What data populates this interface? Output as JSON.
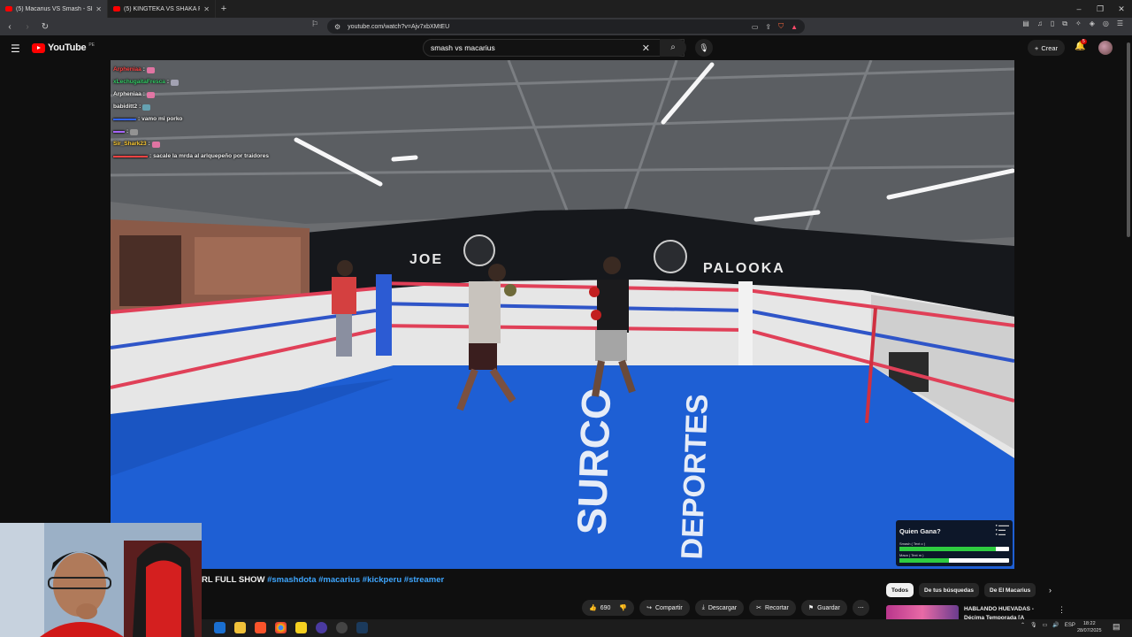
{
  "browser": {
    "tabs": [
      {
        "title": "(5) Macarius VS Smash - SPA..."
      },
      {
        "title": "(5) KINGTEKA VS SHAKA PELEAN EN..."
      }
    ],
    "url": "youtube.com/watch?v=Ajv7xbXMtEU"
  },
  "youtube": {
    "logo": "YouTube",
    "country": "PE",
    "search_query": "smash vs macarius",
    "create_label": "Crear",
    "notification_count": "5"
  },
  "chat": [
    {
      "user": "Arpheniaa",
      "msg": "",
      "color": "#ff4444"
    },
    {
      "user": "xLechugaitaFresca",
      "msg": "",
      "color": "#33cc66"
    },
    {
      "user": "Arpheniaa",
      "msg": "",
      "color": "#ffffff"
    },
    {
      "user": "babiditt2",
      "msg": "",
      "color": "#ffffff"
    },
    {
      "user": "",
      "msg": "vamo mi porko",
      "color": "#3366ff"
    },
    {
      "user": "",
      "msg": "",
      "color": "#aa66ff"
    },
    {
      "user": "Sir_Shark23",
      "msg": "",
      "color": "#ffcc33"
    },
    {
      "user": "",
      "msg": "sacale la mrda al arlquepeño por traidores",
      "color": "#ff4444"
    }
  ],
  "poll": {
    "question": "Quien Gana?",
    "options": [
      {
        "label": "Smash ( Text o )",
        "share": 0.88
      },
      {
        "label": "Maca ( Text m )",
        "share": 0.45
      }
    ]
  },
  "video": {
    "title_prefix": "RL FULL SHOW",
    "hashtags": "#smashdota #macarius #kickperu #streamer",
    "likes": "690"
  },
  "actions": {
    "share": "Compartir",
    "download": "Descargar",
    "clip": "Recortar",
    "save": "Guardar"
  },
  "chips": [
    "Todos",
    "De tus búsquedas",
    "De El Macarius"
  ],
  "recommended": {
    "title": "HABLANDO HUEVADAS - Décima Temporada [A RICARD..."
  },
  "taskbar": {
    "lang": "ESP",
    "time": "18:22",
    "date": "28/07/2025"
  },
  "icons": {
    "back": "back-arrow-icon",
    "forward": "forward-arrow-icon",
    "reload": "reload-icon",
    "search": "search-icon",
    "mic": "mic-icon",
    "bell": "bell-icon"
  },
  "colors": {
    "yt_red": "#ff0000",
    "link_blue": "#3ea6ff",
    "ring_mat": "#1e5fd4"
  }
}
